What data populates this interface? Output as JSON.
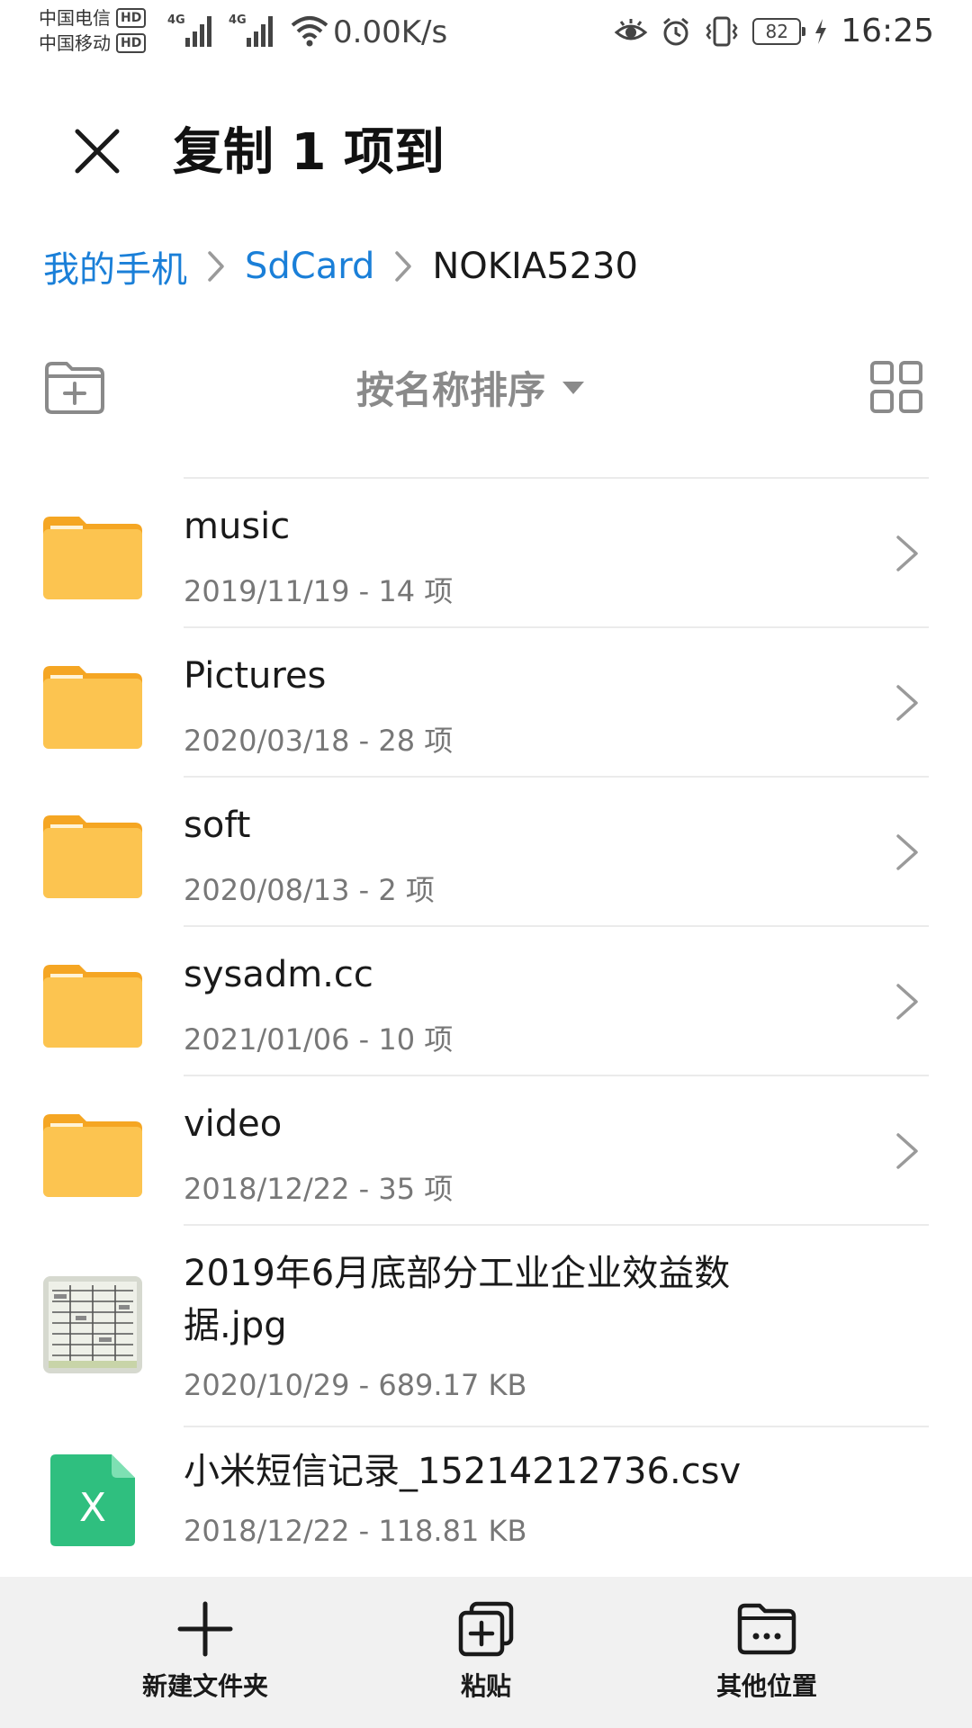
{
  "status_bar": {
    "carrier_1": "中国电信",
    "carrier_2": "中国移动",
    "hd_badge": "HD",
    "network_1": "4G",
    "network_2": "4G",
    "net_speed": "0.00K/s",
    "battery_level": "82",
    "time": "16:25"
  },
  "header": {
    "title": "复制 1 项到"
  },
  "breadcrumb": [
    {
      "label": "我的手机",
      "link": true
    },
    {
      "label": "SdCard",
      "link": true
    },
    {
      "label": "NOKIA5230",
      "link": false
    }
  ],
  "toolbar": {
    "sort_label": "按名称排序"
  },
  "files": [
    {
      "type": "folder",
      "name": "music",
      "meta": "2019/11/19 - 14 项"
    },
    {
      "type": "folder",
      "name": "Pictures",
      "meta": "2020/03/18 - 28 项"
    },
    {
      "type": "folder",
      "name": "soft",
      "meta": "2020/08/13 - 2 项"
    },
    {
      "type": "folder",
      "name": "sysadm.cc",
      "meta": "2021/01/06 - 10 项"
    },
    {
      "type": "folder",
      "name": "video",
      "meta": "2018/12/22 - 35 项"
    },
    {
      "type": "image",
      "name_line_1": "2019年6月底部分工业企业效益数",
      "name_line_2": "据.jpg",
      "meta": "2020/10/29 - 689.17 KB"
    },
    {
      "type": "spreadsheet",
      "name": "小米短信记录_15214212736.csv",
      "meta": "2018/12/22 - 118.81 KB",
      "icon_glyph": "X"
    }
  ],
  "bottom_bar": {
    "new_folder": "新建文件夹",
    "paste": "粘贴",
    "other_location": "其他位置"
  },
  "colors": {
    "accent": "#1a7fd8",
    "folder": "#fcc450",
    "folder_tab": "#f5a623",
    "spreadsheet": "#2fbf7f"
  }
}
